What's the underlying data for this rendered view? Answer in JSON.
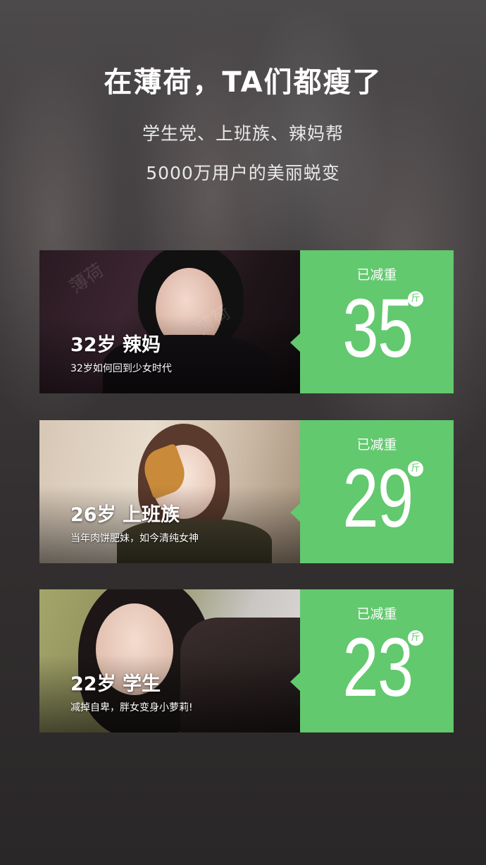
{
  "header": {
    "title": "在薄荷，TA们都瘦了",
    "subtitle_line1": "学生党、上班族、辣妈帮",
    "subtitle_line2": "5000万用户的美丽蜕变"
  },
  "cards": [
    {
      "person_title": "32岁  辣妈",
      "person_desc": "32岁如何回到少女时代",
      "lost_label": "已减重",
      "weight": "35",
      "unit": "斤",
      "watermark": "薄荷"
    },
    {
      "person_title": "26岁  上班族",
      "person_desc": "当年肉饼肥妹，如今清纯女神",
      "lost_label": "已减重",
      "weight": "29",
      "unit": "斤"
    },
    {
      "person_title": "22岁  学生",
      "person_desc": "减掉自卑，胖女变身小萝莉!",
      "lost_label": "已减重",
      "weight": "23",
      "unit": "斤"
    }
  ],
  "colors": {
    "accent_green": "#62c96e",
    "background": "#2b2829",
    "text_white": "#ffffff"
  }
}
